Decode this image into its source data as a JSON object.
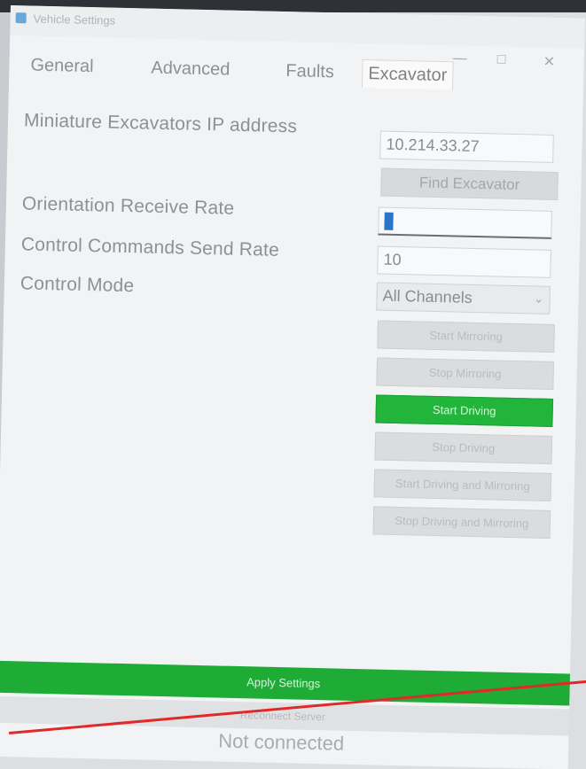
{
  "window": {
    "title": "Vehicle Settings"
  },
  "tabs": [
    {
      "label": "General",
      "active": false
    },
    {
      "label": "Advanced",
      "active": false
    },
    {
      "label": "Faults",
      "active": false
    },
    {
      "label": "Excavator",
      "active": true
    }
  ],
  "excavator": {
    "ip_label": "Miniature Excavators IP address",
    "ip_value": "10.214.33.27",
    "find_button": "Find Excavator",
    "orientation_label": "Orientation Receive Rate",
    "orientation_value": "1",
    "control_rate_label": "Control Commands Send Rate",
    "control_rate_value": "10",
    "control_mode_label": "Control Mode",
    "control_mode_value": "All Channels",
    "buttons": {
      "start_mirroring": "Start Mirroring",
      "stop_mirroring": "Stop Mirroring",
      "start_driving": "Start Driving",
      "stop_driving": "Stop Driving",
      "start_driving_mirroring": "Start Driving and Mirroring",
      "stop_driving_mirroring": "Stop Driving and Mirroring"
    }
  },
  "footer": {
    "save_button": "Apply Settings",
    "secondary_button": "Reconnect Server",
    "status_text": "Not connected"
  },
  "colors": {
    "accent_green": "#22b53c",
    "annotation_red": "#e02a2a"
  }
}
